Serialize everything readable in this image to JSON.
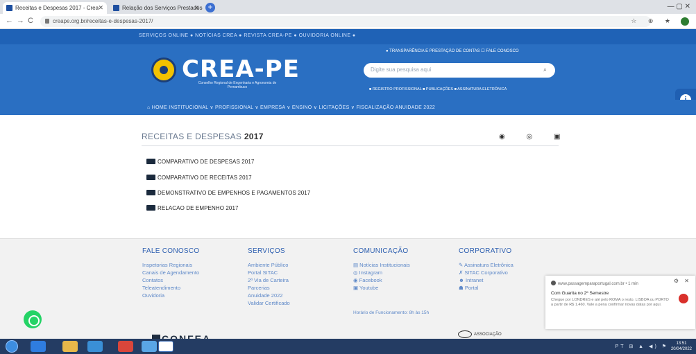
{
  "browser": {
    "tabs": [
      {
        "title": "Receitas e Despesas 2017 - Crea",
        "active": true
      },
      {
        "title": "Relação dos Serviços Prestados",
        "active": false
      }
    ],
    "new_tab": "+",
    "window_controls": "—  ▢  ✕",
    "url": "creape.org.br/receitas-e-despesas-2017/",
    "back": "←",
    "forward": "→",
    "reload": "C",
    "extensions": "☆ ⊕ ★"
  },
  "site": {
    "top_links": "SERVIÇOS ONLINE ●   NOTÍCIAS CREA ●   REVISTA CREA-PE ●   OUVIDORIA ONLINE ●",
    "logo_text": "CREA-PE",
    "logo_subtitle": "Conselho Regional de Engenharia e Agronomia de Pernambuco",
    "header_links": "● TRANSPARÊNCIA E PRESTAÇÃO DE CONTAS      ☐ FALE CONOSCO",
    "search_placeholder": "Digite sua pesquisa aqui",
    "search_icon": "⌕",
    "sub_links": "■ REGISTRO PROFISSIONAL    ■ PUBLICAÇÕES    ■ ASSINATURA ELETRÔNICA",
    "nav": "⌂ HOME   INSTITUCIONAL ∨   PROFISSIONAL ∨   EMPRESA ∨   ENSINO ∨   LICITAÇÕES ∨   FISCALIZAÇÃO   ANUIDADE 2022",
    "accessibility_icon": "i"
  },
  "page": {
    "title_prefix": "RECEITAS E DESPESAS",
    "title_year": "2017",
    "social_icons": "◉ ◎ ▣",
    "files": [
      "COMPARATIVO DE DESPESAS 2017",
      "COMPARATIVO DE RECEITAS 2017",
      "DEMONSTRATIVO DE EMPENHOS E PAGAMENTOS 2017",
      "RELACAO DE EMPENHO 2017"
    ]
  },
  "footer": {
    "fale_conosco": {
      "title": "FALE CONOSCO",
      "links": [
        "Inspetorias Regionais",
        "Canais de Agendamento",
        "Contatos",
        "Teleatendimento",
        "Ouvidoria"
      ]
    },
    "servicos": {
      "title": "SERVIÇOS",
      "links": [
        "Ambiente Público",
        "Portal SITAC",
        "2ª Via de Carteira",
        "Parcerias",
        "Anuidade 2022",
        "Validar Certificado"
      ]
    },
    "comunicacao": {
      "title": "COMUNICAÇÃO",
      "links": [
        "Notícias Institucionais",
        "Instagram",
        "Facebook",
        "Youtube"
      ],
      "note": "Horário de Funcionamento: 8h às 15h"
    },
    "corporativo": {
      "title": "CORPORATIVO",
      "links": [
        "Assinatura Eletrônica",
        "SITAC Corporativo",
        "Intranet",
        "Portal"
      ]
    },
    "confea": "CONFEA",
    "associacao": "ASSOCIAÇÃO"
  },
  "notification": {
    "source": "www.passagemparaportugal.com.br • 1 min",
    "title": "Com Guarita no 2º Semestre",
    "body": "Chegue por LONDRES e até pelo ROMA o resto. LISBOA ou PORTO a partir de R$ 1.460. Vale a pena confirmar novas datas por aqui.",
    "controls": "⚙ ✕"
  },
  "taskbar": {
    "tray": "PT ⊞ ▲ ◀) ⚑",
    "time": "13:51",
    "date": "20/04/2022"
  }
}
